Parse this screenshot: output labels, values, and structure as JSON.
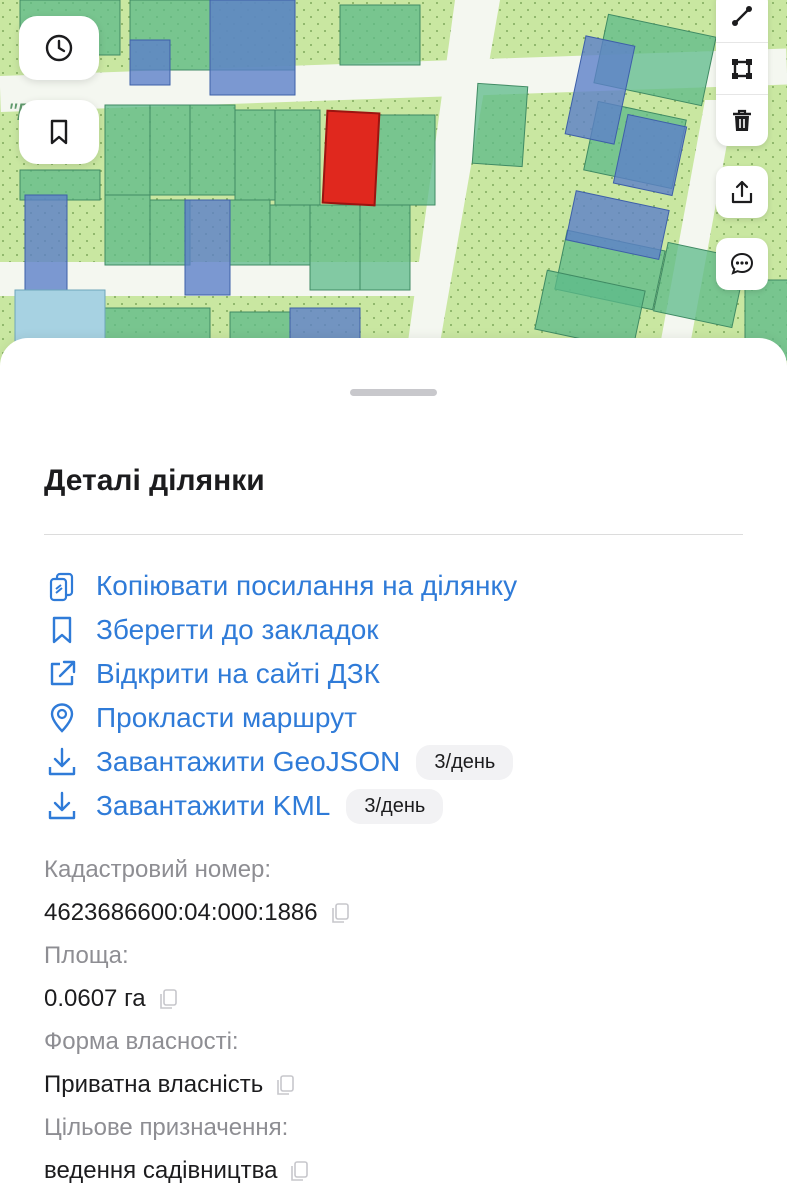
{
  "colors": {
    "accent": "#2f7bd8",
    "selected_parcel": "#e0281e",
    "parcel_green": "#5cba8a",
    "parcel_blue": "#5c7fc9",
    "map_bg": "#c9e7a1"
  },
  "map": {
    "street_label": "\"Г  да\"",
    "buttons": {
      "history_icon": "clock-icon",
      "bookmark_icon": "bookmark-icon"
    },
    "tools": [
      "line-tool-icon",
      "polygon-tool-icon",
      "trash-icon",
      "share-icon",
      "chat-icon"
    ]
  },
  "sheet": {
    "title": "Деталі ділянки",
    "actions": [
      {
        "icon": "copy-link-icon",
        "label": "Копіювати посилання на ділянку"
      },
      {
        "icon": "bookmark-icon",
        "label": "Зберегти до закладок"
      },
      {
        "icon": "external-link-icon",
        "label": "Відкрити на сайті ДЗК"
      },
      {
        "icon": "location-pin-icon",
        "label": "Прокласти маршрут"
      },
      {
        "icon": "download-icon",
        "label": "Завантажити GeoJSON",
        "badge": "3/день"
      },
      {
        "icon": "download-icon",
        "label": "Завантажити KML",
        "badge": "3/день"
      }
    ],
    "fields": [
      {
        "label": "Кадастровий номер:",
        "value": "4623686600:04:000:1886"
      },
      {
        "label": "Площа:",
        "value": "0.0607 га"
      },
      {
        "label": "Форма власності:",
        "value": "Приватна власність"
      },
      {
        "label": "Цільове призначення:",
        "value": "ведення садівництва"
      }
    ]
  }
}
